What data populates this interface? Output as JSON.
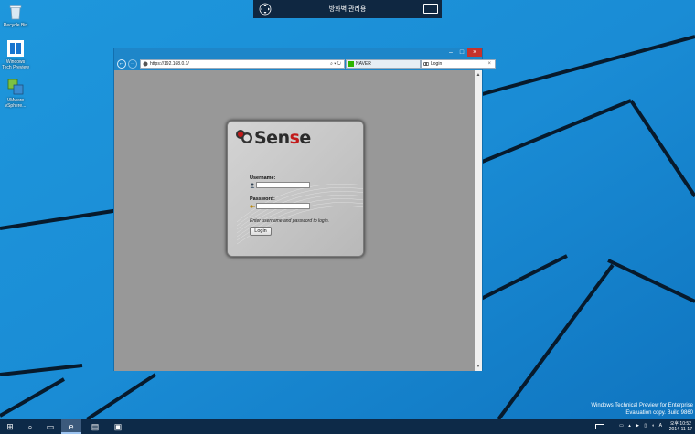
{
  "desktop": {
    "icons": [
      {
        "label": "Recycle Bin",
        "icon": "recycle-bin-icon"
      },
      {
        "label": "Windows Tech Preview",
        "icon": "windows-icon"
      },
      {
        "label": "VMware vSphere...",
        "icon": "vsphere-icon"
      }
    ],
    "watermark": {
      "line1": "Windows Technical Preview for Enterprise",
      "line2": "Evaluation copy. Build 9860"
    }
  },
  "remote_bar": {
    "title": "방화벽 관리용",
    "move_icon": "move-arrows-icon",
    "keyboard_icon": "keyboard-icon"
  },
  "browser": {
    "caption_buttons": {
      "minimize": "–",
      "maximize": "□",
      "close": "×"
    },
    "back": "←",
    "forward": "→",
    "address": "https://192.168.0.1/",
    "address_tools": "⌕ ▾ ↻",
    "tabs": [
      {
        "label": "NAVER",
        "icon": "naver-icon",
        "active": false
      },
      {
        "label": "Login",
        "icon": "pfsense-icon",
        "active": true,
        "close": "×"
      }
    ],
    "toolbar_icons": [
      "home-icon",
      "star-icon",
      "gear-icon"
    ],
    "toolbar_glyphs": "⌂★⚙"
  },
  "login": {
    "logo_prefix": "",
    "logo_text_a": "Sen",
    "logo_text_b": "s",
    "logo_text_c": "e",
    "username_label": "Username:",
    "username_value": "",
    "password_label": "Password:",
    "password_value": "",
    "hint": "Enter username and password to login.",
    "button": "Login"
  },
  "taskbar": {
    "items": [
      {
        "name": "start",
        "glyph": "⊞"
      },
      {
        "name": "search",
        "glyph": "⌕"
      },
      {
        "name": "task-view",
        "glyph": "▭"
      },
      {
        "name": "internet-explorer",
        "glyph": "e"
      },
      {
        "name": "file-explorer",
        "glyph": "▤"
      },
      {
        "name": "store",
        "glyph": "▣"
      }
    ],
    "tray": "▭ ▴ ▶ ▯ ◖ A",
    "clock_time": "오후 10:52",
    "clock_date": "2014-11-17"
  },
  "colors": {
    "desktop_blue": "#1a8fd6",
    "browser_frame": "#1e86c9",
    "close_red": "#c7322c",
    "viewport_gray": "#989898",
    "logo_red": "#c21b1b",
    "taskbar": "#0d2a48"
  }
}
